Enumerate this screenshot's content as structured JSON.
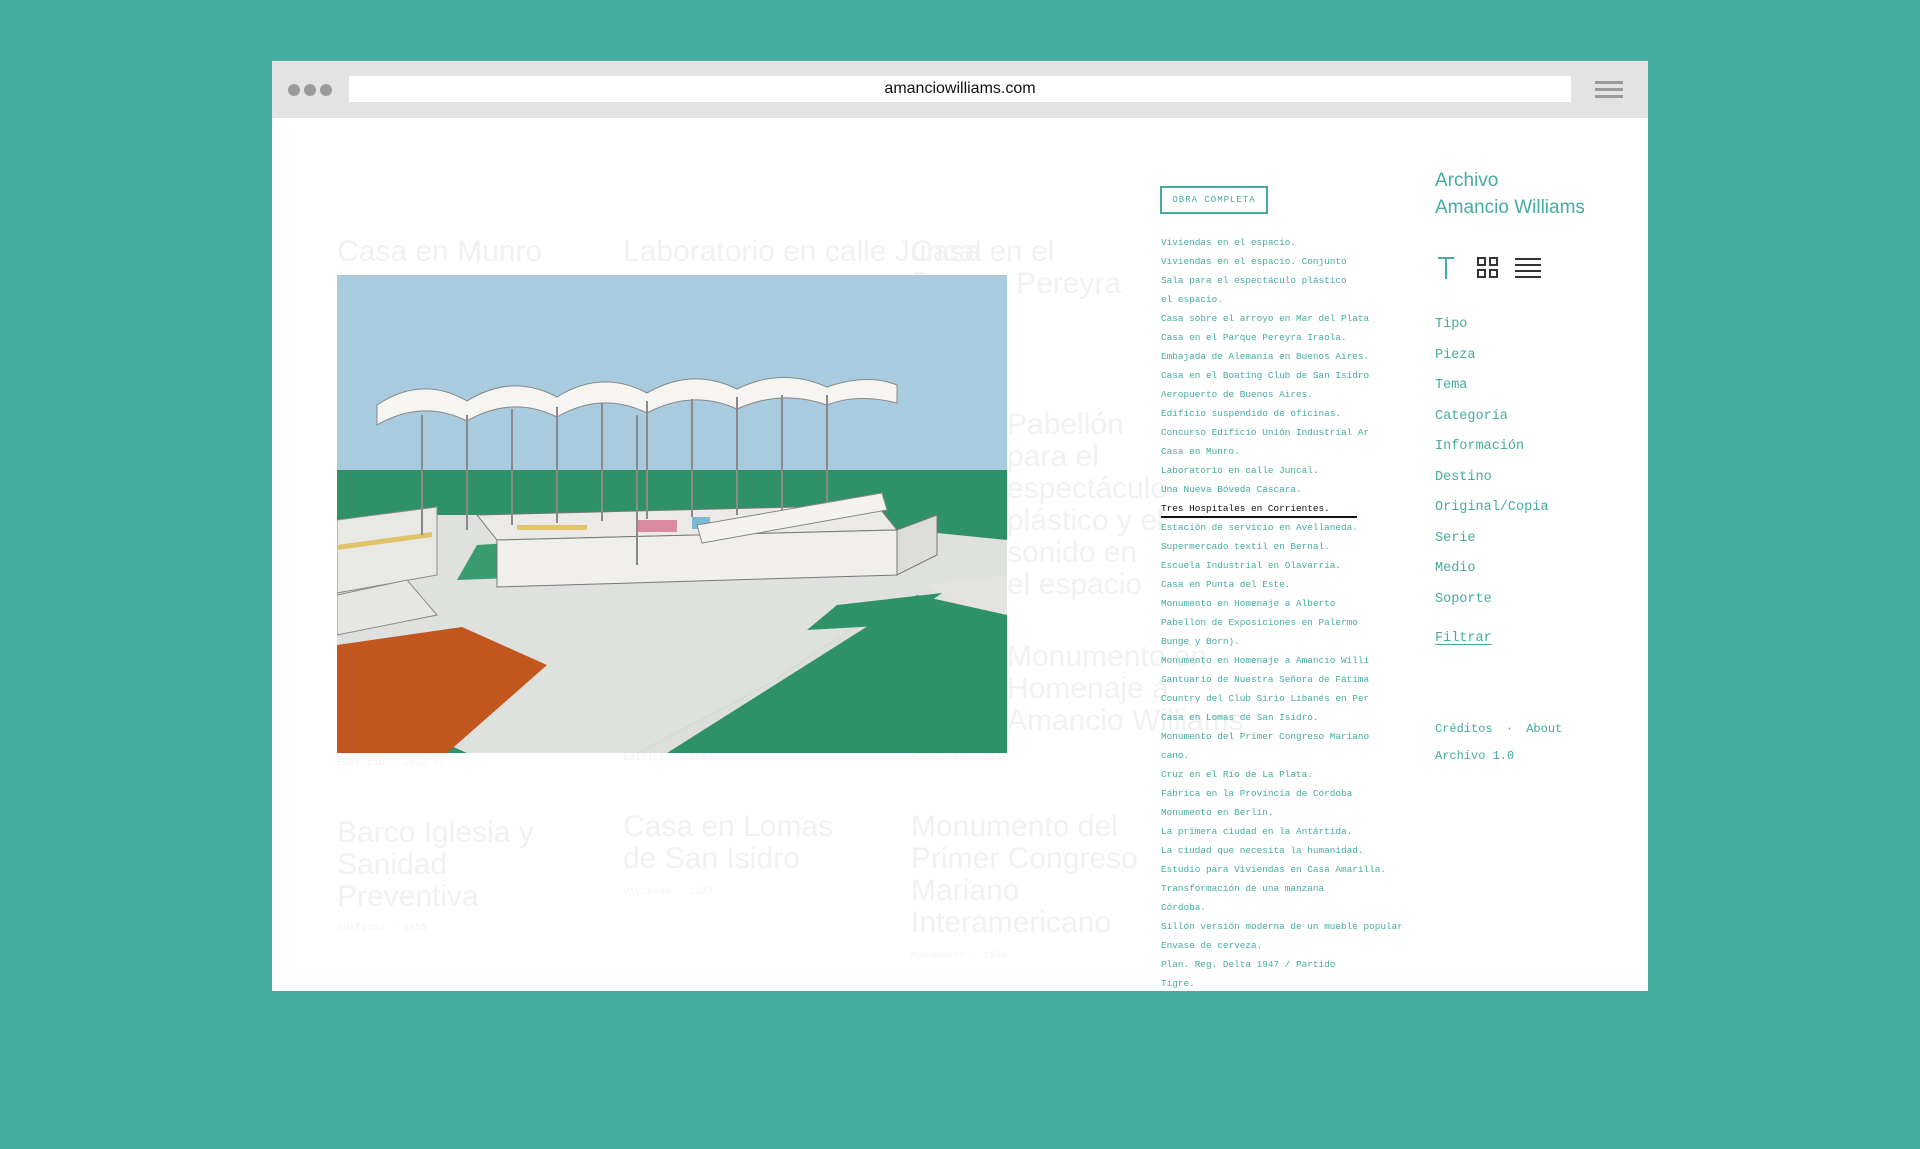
{
  "browser": {
    "url": "amanciowilliams.com"
  },
  "ghost_grid": [
    {
      "title": "Casa en Munro",
      "meta": "Edificio · 1948-51"
    },
    {
      "title": "Laboratorio en calle Juncal",
      "meta": "Edificio · 1950"
    },
    {
      "title": "Casa en el Parque Pereyra",
      "meta": ""
    },
    {
      "title": "Pabellón para el espectáculo plástico y el sonido en el espacio",
      "meta": ""
    },
    {
      "title": "Monumento en Homenaje a Amancio Williams",
      "meta": "Monumento · 1948"
    },
    {
      "title": "Barco Iglesia y Sanidad Preventiva",
      "meta": "Edificio · 1955"
    },
    {
      "title": "Casa en Lomas de San Isidro",
      "meta": "Vivienda · 1957"
    },
    {
      "title": "Monumento del Primer Congreso Mariano Interamericano",
      "meta": "Monumento · 1959"
    }
  ],
  "works_button": "OBRA COMPLETA",
  "works": [
    "Viviendas en el espacio.",
    "Viviendas en el espacio. Conjunto",
    "Sala para el espectáculo plástico",
    "el espacio.",
    "Casa sobre el arroyo en Mar del Plata",
    "Casa en el Parque Pereyra Iraola.",
    "Embajada de Alemania en Buenos Aires.",
    "Casa en el Boating Club de San Isidro",
    "Aeropuerto de Buenos Aires.",
    "Edificio suspendido de oficinas.",
    "Concurso Edificio Unión Industrial Ar",
    "Casa en Munro.",
    "Laboratorio en calle Juncal.",
    "Una Nueva Bóveda Cáscara.",
    "Tres Hospitales en Corrientes.",
    "Estación de servicio en Avellaneda.",
    "Supermercado textil en Bernal.",
    "Escuela Industrial en Olavarría.",
    "Casa en Punta del Este.",
    "Monumento en Homenaje a Alberto",
    "Pabellón de Exposiciones en Palermo",
    "Bunge y Born).",
    "Monumento en Homenaje a Amancio Willi",
    "Santuario de Nuestra Señora de Fátima",
    "Country del Club Sirio Libanés en Per",
    "Casa en Lomas de San Isidro.",
    "Monumento del Primer Congreso Mariano",
    "cano.",
    "Cruz en el Río de La Plata.",
    "Fábrica en la Provincia de Córdoba",
    "Monumento en Berlín.",
    "La primera ciudad en la Antártida.",
    "La ciudad que necesita la humanidad.",
    "Estudio para Viviendas en  Casa Amarilla.",
    "Transformación de una manzana",
    "Córdoba.",
    "Sillón versión moderna de un mueble popular.",
    "Envase de cerveza.",
    "Plan. Reg. Delta 1947 / Partido",
    "Tigre."
  ],
  "active_work_index": 14,
  "brand": {
    "line1": "Archivo",
    "line2": "Amancio Williams"
  },
  "view_icons": [
    "text-view-icon",
    "grid-view-icon",
    "list-view-icon"
  ],
  "filters": [
    "Tipo",
    "Pieza",
    "Tema",
    "Categoría",
    "Información",
    "Destino",
    "Original/Copia",
    "Serie",
    "Medio",
    "Soporte"
  ],
  "filter_action": "Filtrar",
  "footer": {
    "credits": "Créditos",
    "separator": "·",
    "about": "About",
    "version": "Archivo 1.0"
  },
  "colors": {
    "accent": "#45aca1",
    "background": "#45aca1",
    "ghost_text": "#f1f1f1"
  }
}
